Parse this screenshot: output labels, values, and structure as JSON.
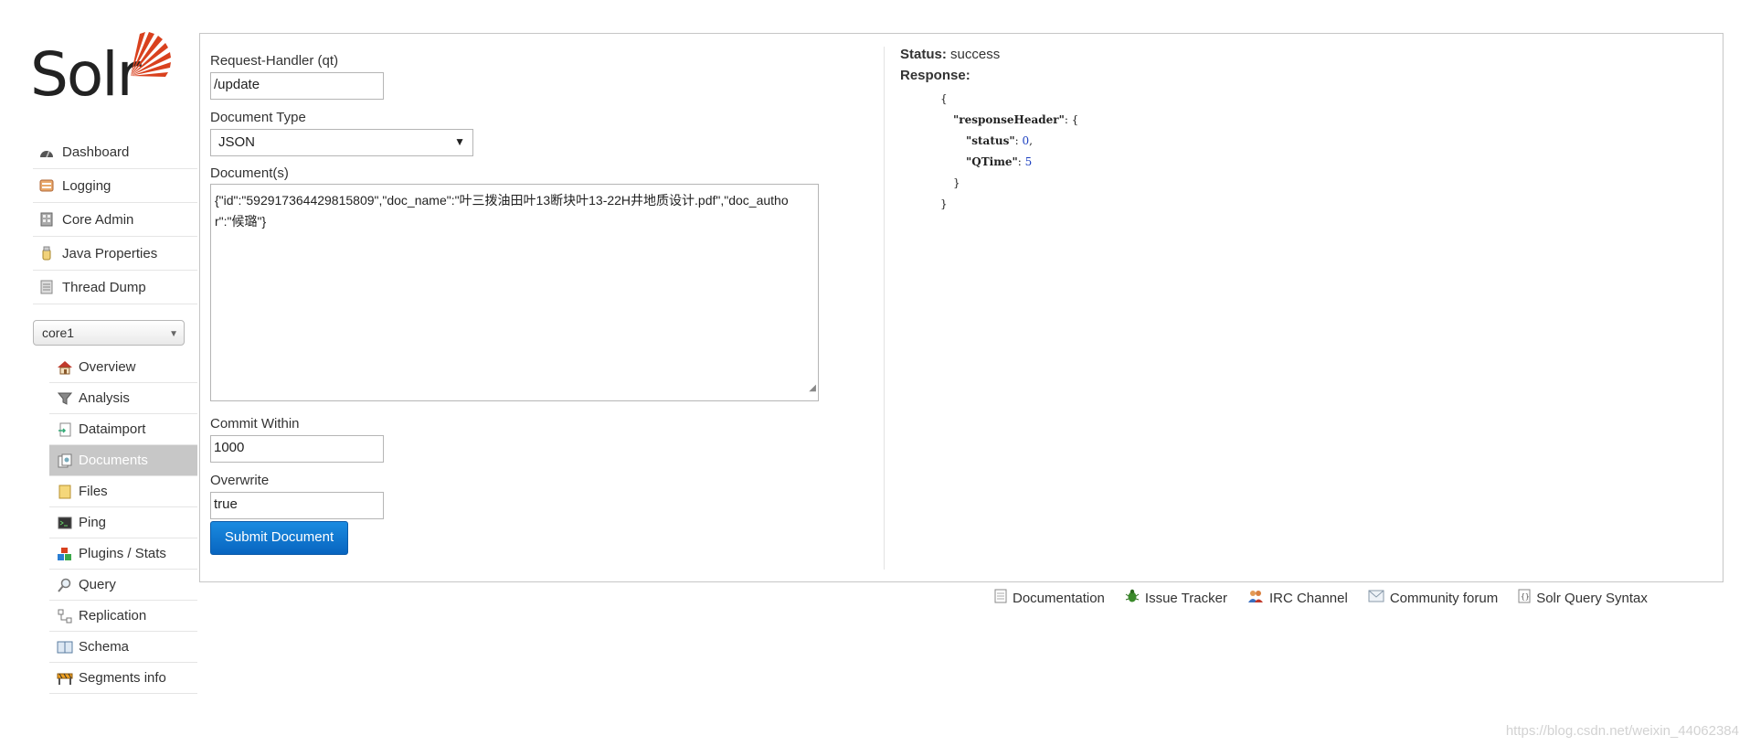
{
  "logo": {
    "text": "Solr"
  },
  "nav": [
    {
      "icon": "dashboard-icon",
      "label": "Dashboard"
    },
    {
      "icon": "logging-icon",
      "label": "Logging"
    },
    {
      "icon": "core-admin-icon",
      "label": "Core Admin"
    },
    {
      "icon": "java-properties-icon",
      "label": "Java Properties"
    },
    {
      "icon": "thread-dump-icon",
      "label": "Thread Dump"
    }
  ],
  "core_selector": {
    "value": "core1"
  },
  "core_nav": [
    {
      "icon": "house-icon",
      "label": "Overview"
    },
    {
      "icon": "funnel-icon",
      "label": "Analysis"
    },
    {
      "icon": "dataimport-icon",
      "label": "Dataimport"
    },
    {
      "icon": "documents-icon",
      "label": "Documents",
      "active": true
    },
    {
      "icon": "folder-icon",
      "label": "Files"
    },
    {
      "icon": "terminal-icon",
      "label": "Ping"
    },
    {
      "icon": "blocks-icon",
      "label": "Plugins / Stats"
    },
    {
      "icon": "magnifier-icon",
      "label": "Query"
    },
    {
      "icon": "replication-icon",
      "label": "Replication"
    },
    {
      "icon": "book-icon",
      "label": "Schema"
    },
    {
      "icon": "barrier-icon",
      "label": "Segments info"
    }
  ],
  "form": {
    "handler_label": "Request-Handler (qt)",
    "handler_value": "/update",
    "doctype_label": "Document Type",
    "doctype_value": "JSON",
    "docs_label": "Document(s)",
    "docs_value": "{\"id\":\"592917364429815809\",\"doc_name\":\"叶三拨油田叶13断块叶13-22H井地质设计.pdf\",\"doc_author\":\"候璐\"}",
    "commit_label": "Commit Within",
    "commit_value": "1000",
    "overwrite_label": "Overwrite",
    "overwrite_value": "true",
    "submit_label": "Submit Document"
  },
  "result": {
    "status_label": "Status:",
    "status_value": "success",
    "response_label": "Response:",
    "json": {
      "open": "{",
      "rh_key": "\"responseHeader\"",
      "rh_open": ": {",
      "status_key": "\"status\"",
      "status_val": "0",
      "qtime_key": "\"QTime\"",
      "qtime_val": "5",
      "inner_close": "}",
      "close": "}"
    }
  },
  "footer": [
    {
      "icon": "document-icon",
      "label": "Documentation"
    },
    {
      "icon": "bug-icon",
      "label": "Issue Tracker"
    },
    {
      "icon": "people-icon",
      "label": "IRC Channel"
    },
    {
      "icon": "mail-icon",
      "label": "Community forum"
    },
    {
      "icon": "syntax-icon",
      "label": "Solr Query Syntax"
    }
  ],
  "watermark": "https://blog.csdn.net/weixin_44062384"
}
